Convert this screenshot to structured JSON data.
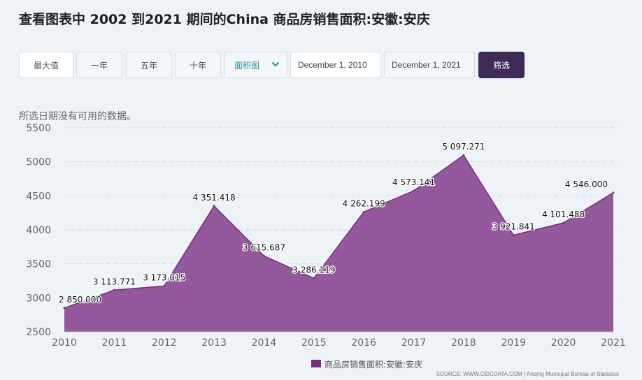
{
  "page": {
    "title": "查看图表中 2002 到2021 期间的China 商品房销售面积:安徽:安庆",
    "note": "所选日期没有可用的数据。",
    "source": "SOURCE: WWW.CEICDATA.COM | Anqing Municipal Bureau of Statistics"
  },
  "toolbar": {
    "buttons": [
      "最大值",
      "一年",
      "五年",
      "十年"
    ],
    "chart_type": "面积图",
    "date_from": "December 1, 2010",
    "date_to": "December 1, 2021",
    "filter_label": "筛选"
  },
  "colors": {
    "area_fill": "#8e4f97",
    "area_line": "#7a2e83",
    "filter_bg": "#3d2a56"
  },
  "chart_data": {
    "type": "area",
    "x": [
      "2010",
      "2011",
      "2012",
      "2013",
      "2014",
      "2015",
      "2016",
      "2017",
      "2018",
      "2019",
      "2020",
      "2021"
    ],
    "series": [
      {
        "name": "商品房销售面积:安徽:安庆",
        "values": [
          2850.0,
          3113.771,
          3173.015,
          4351.418,
          3615.687,
          3286.119,
          4262.199,
          4573.141,
          5097.271,
          3921.841,
          4101.488,
          4546.0
        ],
        "labels": [
          "2 850.000",
          "3 113.771",
          "3 173.015",
          "4 351.418",
          "3 615.687",
          "3 286.119",
          "4 262.199",
          "4 573.141",
          "5 097.271",
          "3 921.841",
          "4 101.488",
          "4 546.000"
        ]
      }
    ],
    "ylim": [
      2500,
      5500
    ],
    "yticks": [
      "2500",
      "3000",
      "3500",
      "4000",
      "4500",
      "5000",
      "5500"
    ],
    "grid": true,
    "legend": "bottom-center"
  }
}
